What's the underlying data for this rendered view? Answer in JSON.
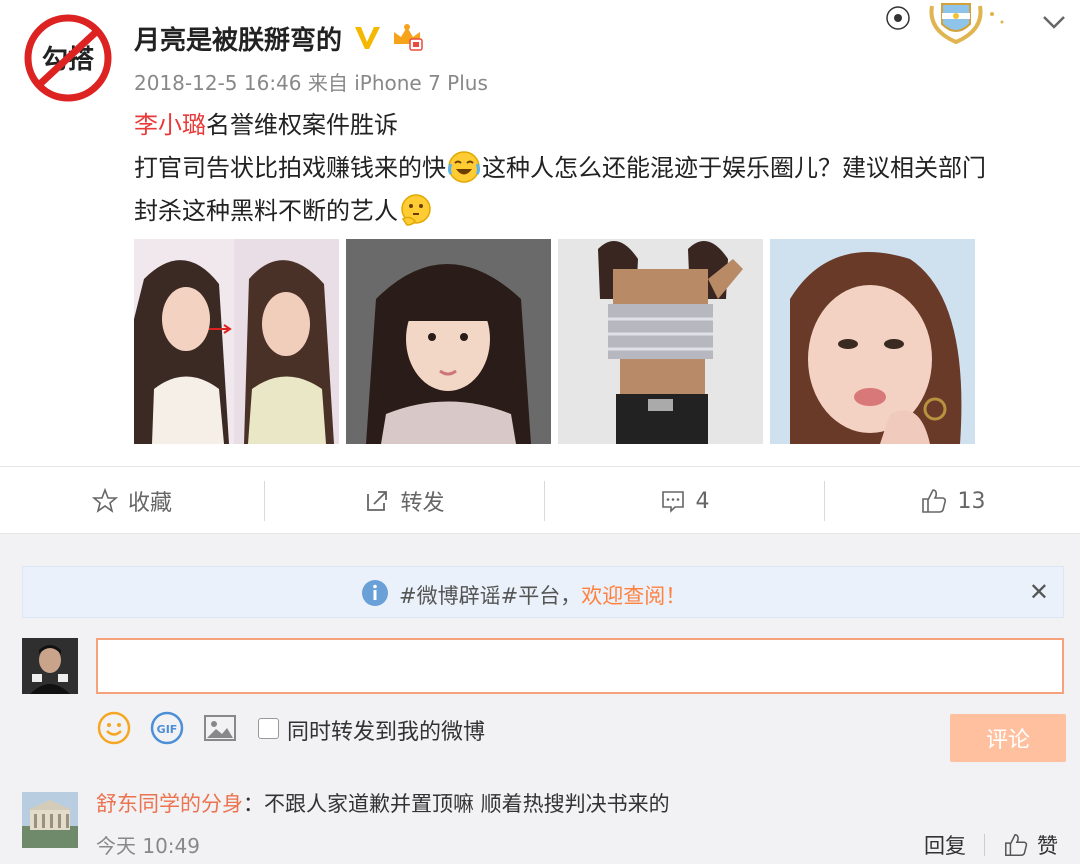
{
  "post": {
    "avatar_text": "勾搭",
    "username": "月亮是被朕掰弯的",
    "timestamp": "2018-12-5 16:46 来自 iPhone 7 Plus",
    "content": {
      "mention": "李小璐",
      "line1_rest": "名誉维权案件胜诉",
      "line2a": "打官司告状比拍戏赚钱来的快",
      "line2b": "这种人怎么还能混迹于娱乐圈儿？建议相关部门",
      "line3": "封杀这种黑料不断的艺人"
    },
    "photo_count": 4
  },
  "actions": {
    "favorite": "收藏",
    "repost": "转发",
    "comments": "4",
    "likes": "13"
  },
  "comment_box": {
    "notice_prefix": "#微博辟谣#平台，",
    "notice_link": "欢迎查阅！",
    "notice_close": "✕",
    "input_value": "",
    "also_repost_label": "同时转发到我的微博",
    "submit_label": "评论"
  },
  "replies": [
    {
      "author": "舒东同学的分身",
      "separator": "：",
      "text": "不跟人家道歉并置顶嘛  顺着热搜判决书来的",
      "time": "今天 10:49",
      "reply_label": "回复",
      "like_label": "赞"
    }
  ],
  "colors": {
    "accent": "#ff8140",
    "mention": "#e83a3a",
    "author": "#eb7350",
    "submit_bg": "#ffc09f",
    "input_border": "#f5a27a"
  }
}
